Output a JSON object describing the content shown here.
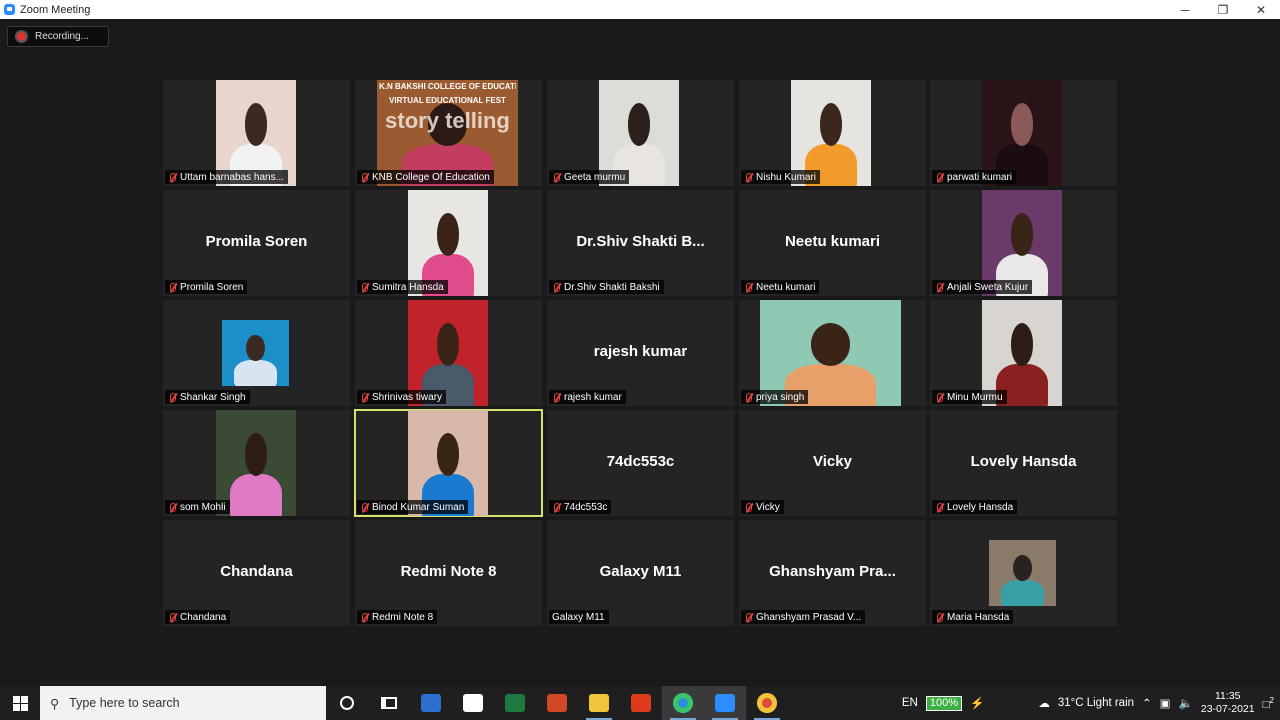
{
  "window": {
    "title": "Zoom Meeting",
    "minimize": "─",
    "maximize": "❐",
    "close": "✕"
  },
  "recording": {
    "label": "Recording..."
  },
  "participants": [
    {
      "name": "Uttam barnabas hans...",
      "video": true,
      "colors": [
        "#e8d5cc",
        "#3a2a22",
        "#f2f2f2"
      ]
    },
    {
      "name": "KNB College Of Education",
      "video": true,
      "colors": [
        "#9b5a30",
        "#2b1a14",
        "#c23d60"
      ],
      "overlay_text": [
        "K.N BAKSHI COLLEGE OF EDUCATION",
        "VIRTUAL EDUCATIONAL FEST",
        "story telling"
      ]
    },
    {
      "name": "Geeta murmu",
      "video": true,
      "colors": [
        "#dcdcd8",
        "#2b201a",
        "#e8e4e0"
      ]
    },
    {
      "name": "Nishu Kumari",
      "video": true,
      "colors": [
        "#e6e4df",
        "#3a261c",
        "#f29a2a"
      ]
    },
    {
      "name": "parwati kumari",
      "video": true,
      "colors": [
        "#2a1418",
        "#8a5a5a",
        "#1a0c10"
      ]
    },
    {
      "name": "Promila Soren",
      "video": false,
      "display": "Promila Soren"
    },
    {
      "name": "Sumitra Hansda",
      "video": true,
      "colors": [
        "#e8e6e3",
        "#3a2418",
        "#e04c8c"
      ]
    },
    {
      "name": "Dr.Shiv Shakti Bakshi",
      "video": false,
      "display": "Dr.Shiv  Shakti  B..."
    },
    {
      "name": "Neetu kumari",
      "video": false,
      "display": "Neetu kumari"
    },
    {
      "name": "Anjali Sweta Kujur",
      "video": true,
      "colors": [
        "#6b3a6a",
        "#3a2418",
        "#e8e8e8"
      ]
    },
    {
      "name": "Shankar Singh",
      "video": true,
      "colors": [
        "#1b8fc8",
        "#3a2a22",
        "#d8e4f0"
      ]
    },
    {
      "name": "Shrinivas tiwary",
      "video": true,
      "colors": [
        "#c0242a",
        "#3a2418",
        "#4a5a6a"
      ]
    },
    {
      "name": "rajesh kumar",
      "video": false,
      "display": "rajesh kumar"
    },
    {
      "name": "priya singh",
      "video": true,
      "colors": [
        "#8fc9b4",
        "#3a2418",
        "#e8a06a"
      ]
    },
    {
      "name": "Minu Murmu",
      "video": true,
      "colors": [
        "#d8d4d0",
        "#2e1c16",
        "#8a2020"
      ]
    },
    {
      "name": "som Mohli",
      "video": true,
      "colors": [
        "#3a4a34",
        "#2e1c16",
        "#e07ac4"
      ]
    },
    {
      "name": "Binod Kumar Suman",
      "video": true,
      "active": true,
      "colors": [
        "#d8b8a8",
        "#3a2418",
        "#1a7ad0"
      ]
    },
    {
      "name": "74dc553c",
      "video": false,
      "display": "74dc553c"
    },
    {
      "name": "Vicky",
      "video": false,
      "display": "Vicky"
    },
    {
      "name": "Lovely Hansda",
      "video": false,
      "display": "Lovely Hansda"
    },
    {
      "name": "Chandana",
      "video": false,
      "display": "Chandana"
    },
    {
      "name": "Redmi Note 8",
      "video": false,
      "display": "Redmi Note 8"
    },
    {
      "name": "Galaxy M11",
      "video": false,
      "display": "Galaxy M11",
      "unmuted": true
    },
    {
      "name": "Ghanshyam Prasad V...",
      "video": false,
      "display": "Ghanshyam  Pra..."
    },
    {
      "name": "Maria Hansda",
      "video": true,
      "colors": [
        "#8a7a6a",
        "#2a2220",
        "#3aa0a8"
      ]
    }
  ],
  "taskbar": {
    "search_placeholder": "Type here to search",
    "apps": [
      {
        "name": "cortana",
        "color": "#ffffff"
      },
      {
        "name": "task-view",
        "color": "#ffffff"
      },
      {
        "name": "photos",
        "color": "#2f6fcf"
      },
      {
        "name": "store",
        "color": "#ffffff"
      },
      {
        "name": "excel",
        "color": "#1d7a3f"
      },
      {
        "name": "powerpoint",
        "color": "#d24726"
      },
      {
        "name": "file-explorer",
        "color": "#f2c43a"
      },
      {
        "name": "office",
        "color": "#e03a1e"
      },
      {
        "name": "edge",
        "color": "#2a8fd8"
      },
      {
        "name": "zoom",
        "color": "#2d8cff"
      },
      {
        "name": "chrome",
        "color": "#e24a3b"
      }
    ],
    "language": "EN",
    "battery": "100%",
    "weather": "31°C  Light rain",
    "time": "11:35",
    "date": "23-07-2021",
    "notifications": "2"
  }
}
